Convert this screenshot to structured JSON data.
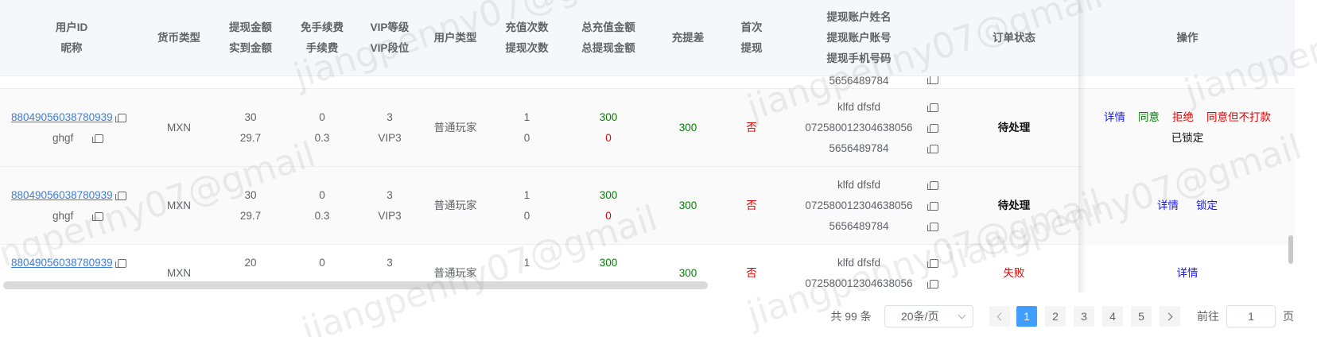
{
  "header": {
    "col_uid": [
      "用户ID",
      "昵称"
    ],
    "col_currency": "货币类型",
    "col_amount": [
      "提现金额",
      "实到金额"
    ],
    "col_fee": [
      "免手续费",
      "手续费"
    ],
    "col_vip": [
      "VIP等级",
      "VIP段位"
    ],
    "col_user_type": "用户类型",
    "col_counts": [
      "充值次数",
      "提现次数"
    ],
    "col_totals": [
      "总充值金额",
      "总提现金额"
    ],
    "col_diff": "充提差",
    "col_first": [
      "首次",
      "提现"
    ],
    "col_account": [
      "提现账户姓名",
      "提现账户账号",
      "提现手机号码"
    ],
    "col_status": "订单状态",
    "col_ops": "操作"
  },
  "rows": [
    {
      "uid": "88049056038780939",
      "nickname": "ghgf",
      "currency": "MXN",
      "amount": "30",
      "actual_amount": "29.7",
      "free_fee": "0",
      "fee": "0.3",
      "vip_level": "3",
      "vip_rank": "VIP3",
      "user_type": "普通玩家",
      "recharge_count": "1",
      "withdraw_count": "0",
      "total_recharge": "300",
      "total_withdraw": "0",
      "diff": "300",
      "first_withdraw": "否",
      "account_name": "klfd dfsfd",
      "account_no": "072580012304638056",
      "phone": "5656489784",
      "status": "待处理",
      "ops": [
        "详情",
        "同意",
        "拒绝",
        "同意但不打款"
      ],
      "locked": "已锁定"
    },
    {
      "uid": "88049056038780939",
      "nickname": "ghgf",
      "currency": "MXN",
      "amount": "30",
      "actual_amount": "29.7",
      "free_fee": "0",
      "fee": "0.3",
      "vip_level": "3",
      "vip_rank": "VIP3",
      "user_type": "普通玩家",
      "recharge_count": "1",
      "withdraw_count": "0",
      "total_recharge": "300",
      "total_withdraw": "0",
      "diff": "300",
      "first_withdraw": "否",
      "account_name": "klfd dfsfd",
      "account_no": "072580012304638056",
      "phone": "5656489784",
      "status": "待处理",
      "ops": [
        "详情",
        "锁定"
      ]
    },
    {
      "uid": "88049056038780939",
      "currency": "MXN",
      "amount": "20",
      "free_fee": "0",
      "vip_level": "3",
      "user_type": "普通玩家",
      "recharge_count": "1",
      "total_recharge": "300",
      "diff": "300",
      "first_withdraw": "否",
      "account_name": "klfd dfsfd",
      "account_no": "072580012304638056",
      "status": "失败",
      "ops": [
        "详情"
      ]
    }
  ],
  "partial_row_text": "5656489784",
  "pagination": {
    "total": "共 99 条",
    "page_size": "20条/页",
    "pages": [
      "1",
      "2",
      "3",
      "4",
      "5"
    ],
    "current": "1",
    "goto_label": "前往",
    "goto_value": "1",
    "page_unit": "页"
  },
  "watermark": "jiangpenny07@gmail"
}
